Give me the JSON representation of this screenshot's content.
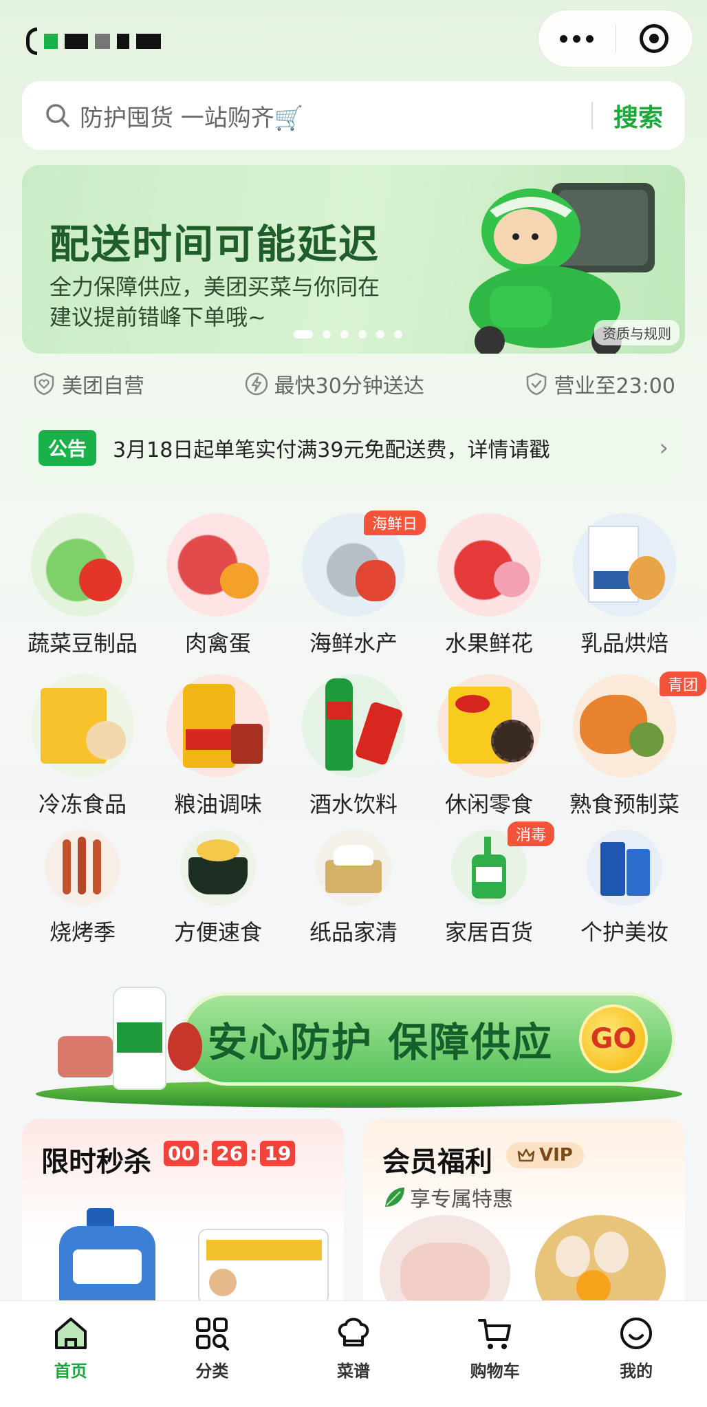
{
  "search": {
    "placeholder": "防护囤货 一站购齐🛒",
    "button": "搜索"
  },
  "banner": {
    "title": "配送时间可能延迟",
    "line1": "全力保障供应，美团买菜与你同在",
    "line2": "建议提前错峰下单哦~",
    "corner_label": "资质与规则"
  },
  "features": [
    {
      "icon": "heart-shield-icon",
      "label": "美团自营"
    },
    {
      "icon": "lightning-icon",
      "label": "最快30分钟送达"
    },
    {
      "icon": "check-shield-icon",
      "label": "营业至23:00"
    }
  ],
  "notice": {
    "tag": "公告",
    "text": "3月18日起单笔实付满39元免配送费，详情请戳"
  },
  "categories_row1": [
    {
      "label": "蔬菜豆制品",
      "badge": ""
    },
    {
      "label": "肉禽蛋",
      "badge": ""
    },
    {
      "label": "海鲜水产",
      "badge": "海鲜日"
    },
    {
      "label": "水果鲜花",
      "badge": ""
    },
    {
      "label": "乳品烘焙",
      "badge": ""
    }
  ],
  "categories_row2": [
    {
      "label": "冷冻食品",
      "badge": ""
    },
    {
      "label": "粮油调味",
      "badge": ""
    },
    {
      "label": "酒水饮料",
      "badge": ""
    },
    {
      "label": "休闲零食",
      "badge": ""
    },
    {
      "label": "熟食预制菜",
      "badge": "青团"
    }
  ],
  "categories_row3": [
    {
      "label": "烧烤季",
      "badge": ""
    },
    {
      "label": "方便速食",
      "badge": ""
    },
    {
      "label": "纸品家清",
      "badge": ""
    },
    {
      "label": "家居百货",
      "badge": "消毒"
    },
    {
      "label": "个护美妆",
      "badge": ""
    }
  ],
  "promo": {
    "text": "安心防护 保障供应",
    "go": "GO"
  },
  "flash_sale": {
    "title": "限时秒杀",
    "hh": "00",
    "mm": "26",
    "ss": "19",
    "sep": ":"
  },
  "member": {
    "title": "会员福利",
    "vip": "VIP",
    "subtitle": "享专属特惠"
  },
  "tabs": [
    {
      "label": "首页",
      "icon": "home-icon"
    },
    {
      "label": "分类",
      "icon": "category-icon"
    },
    {
      "label": "菜谱",
      "icon": "chef-hat-icon"
    },
    {
      "label": "购物车",
      "icon": "cart-icon"
    },
    {
      "label": "我的",
      "icon": "smile-icon"
    }
  ],
  "colors": {
    "brand_green": "#19b24a",
    "accent_red": "#f2433a"
  }
}
